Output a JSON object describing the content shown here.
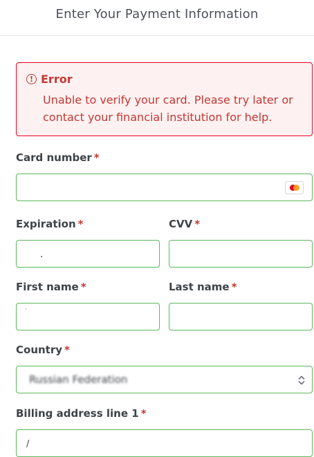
{
  "header": {
    "title": "Enter Your Payment Information"
  },
  "error": {
    "title": "Error",
    "message": "Unable to verify your card. Please try later or contact your financial institution for help."
  },
  "form": {
    "required_mark": "*",
    "card_number": {
      "label": "Card number",
      "value": "",
      "icon": "mastercard-icon"
    },
    "expiration": {
      "label": "Expiration",
      "value": "."
    },
    "cvv": {
      "label": "CVV",
      "value": ""
    },
    "first_name": {
      "label": "First name",
      "value": "'"
    },
    "last_name": {
      "label": "Last name",
      "value": ""
    },
    "country": {
      "label": "Country",
      "value": "Russian Federation"
    },
    "billing_address_1": {
      "label": "Billing address line 1",
      "value": "/"
    }
  },
  "colors": {
    "error": "#c23934",
    "valid_border": "#5cb85c",
    "error_bg": "#fef1f1"
  }
}
